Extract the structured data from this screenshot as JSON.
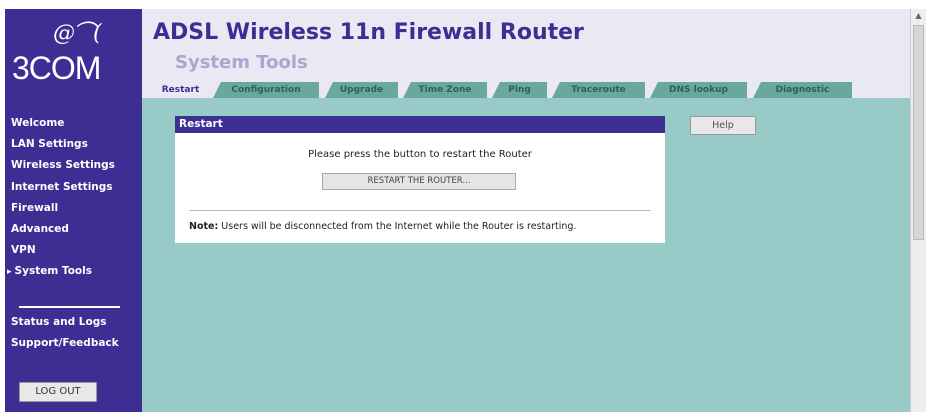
{
  "brand": {
    "logo_mark": "൭൫",
    "logo_text": "3COM"
  },
  "header": {
    "title": "ADSL Wireless 11n Firewall Router",
    "subtitle": "System Tools"
  },
  "sidebar": {
    "items": [
      {
        "label": "Welcome"
      },
      {
        "label": "LAN Settings"
      },
      {
        "label": "Wireless Settings"
      },
      {
        "label": "Internet Settings"
      },
      {
        "label": "Firewall"
      },
      {
        "label": "Advanced"
      },
      {
        "label": "VPN"
      },
      {
        "label": "System Tools"
      }
    ],
    "active_item": "System Tools",
    "secondary_items": [
      {
        "label": "Status and Logs"
      },
      {
        "label": "Support/Feedback"
      }
    ],
    "logout_label": "LOG OUT"
  },
  "tabs": [
    {
      "label": "Restart"
    },
    {
      "label": "Configuration"
    },
    {
      "label": "Upgrade"
    },
    {
      "label": "Time Zone"
    },
    {
      "label": "Ping"
    },
    {
      "label": "Traceroute"
    },
    {
      "label": "DNS lookup"
    },
    {
      "label": "Diagnostic"
    }
  ],
  "active_tab": "Restart",
  "panel": {
    "title": "Restart",
    "message": "Please press the button to restart the Router",
    "button_label": "RESTART THE ROUTER...",
    "note_label": "Note:",
    "note_text": " Users will be disconnected from the Internet while the Router is restarting."
  },
  "help_label": "Help",
  "colors": {
    "brand_purple": "#3c2e93",
    "content_teal": "#98cbc8",
    "tab_green": "#6aa79f",
    "header_bg": "#e9e8f3"
  }
}
